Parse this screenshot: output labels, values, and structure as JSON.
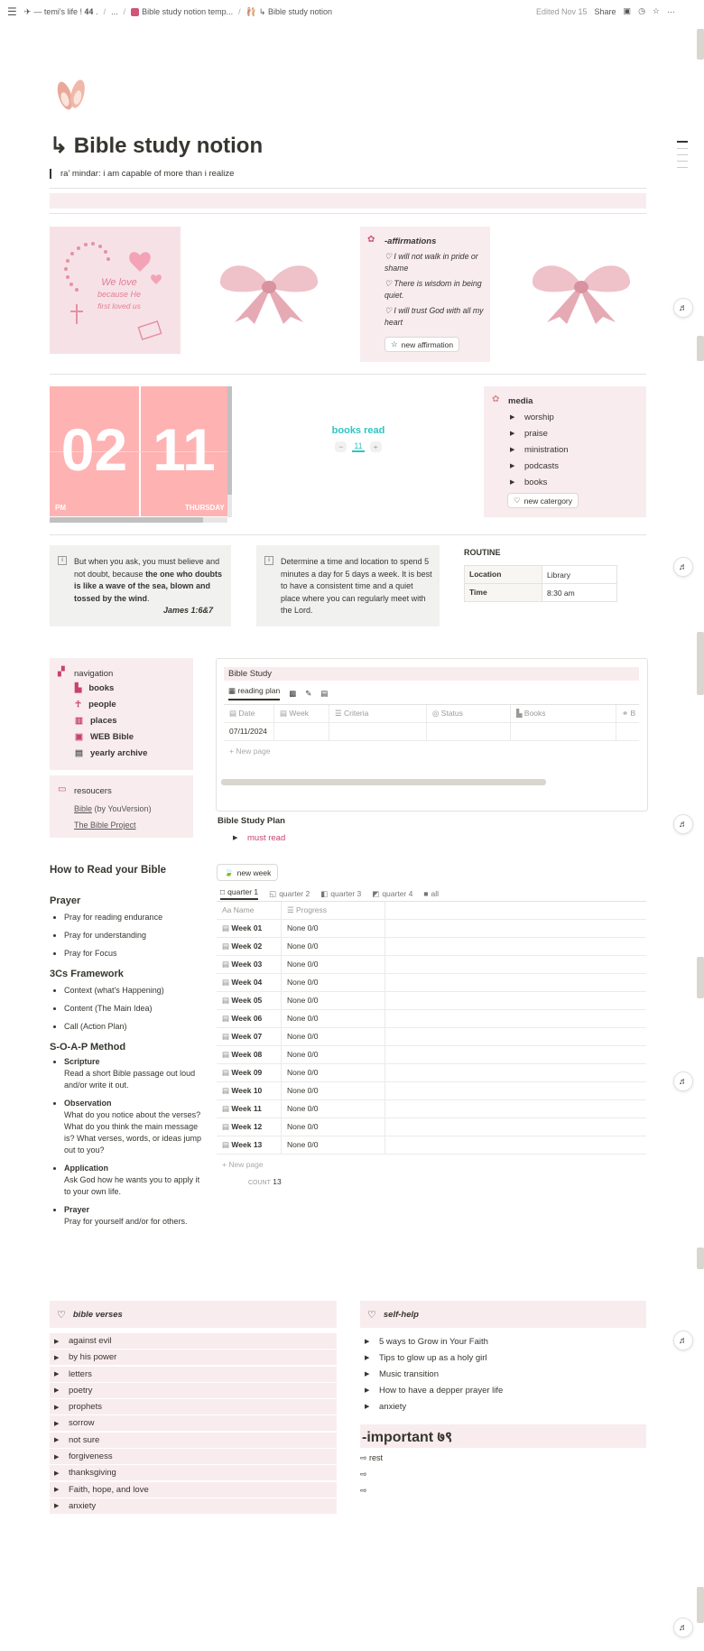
{
  "topbar": {
    "crumbs": [
      "— temi's life ! 𝟒𝟒 .",
      "...",
      "Bible study notion temp...",
      "↳ Bible study notion"
    ],
    "edited": "Edited Nov 15",
    "share": "Share"
  },
  "header": {
    "title": "↳ Bible study notion",
    "quote": "ra' mindar: i am capable of more than i realize"
  },
  "affirmations": {
    "title": "-affirmations",
    "items": [
      "I will not walk in pride or shame",
      "There is wisdom in being quiet.",
      "I will trust God with all my heart"
    ],
    "button": "new affirmation"
  },
  "sticker_text": {
    "line1": "We love",
    "line2": "because He",
    "line3": "first loved us"
  },
  "clock": {
    "hour": "02",
    "minute": "11",
    "period": "PM",
    "day": "THURSDAY"
  },
  "books_read": {
    "label": "books read",
    "value": "11",
    "minus": "−",
    "plus": "+"
  },
  "media": {
    "title": "media",
    "items": [
      "worship",
      "praise",
      "ministration",
      "podcasts",
      "books"
    ],
    "button": "new catergory"
  },
  "callouts": [
    {
      "pre": "But when you ask, you must believe and not doubt, because ",
      "bold": "the one who doubts is like a wave of the sea, blown and tossed by the wind",
      "post": ".",
      "ref": "James 1:6&7"
    },
    {
      "text": "Determine a time and location to spend 5 minutes a day for 5 days a week. It is best to have a consistent time and a quiet place where you can regularly meet with the Lord."
    }
  ],
  "routine": {
    "title": "ROUTINE",
    "rows": [
      {
        "k": "Location",
        "v": "Library"
      },
      {
        "k": "Time",
        "v": "8:30 am"
      }
    ]
  },
  "navigation": {
    "title": "navigation",
    "items": [
      "books",
      "people",
      "places",
      "WEB Bible",
      "yearly archive"
    ]
  },
  "resources": {
    "title": "resoucers",
    "bible_link": "Bible",
    "bible_suffix": " (by YouVersion)",
    "project": "The Bible Project"
  },
  "bible_study_db": {
    "title": "Bible Study",
    "view": "reading plan",
    "columns": [
      "Date",
      "Week",
      "Criteria",
      "Status",
      "Books",
      "B"
    ],
    "rows": [
      {
        "date": "07/11/2024"
      }
    ],
    "new_page": "+ New page"
  },
  "study_plan": {
    "title": "Bible Study Plan",
    "toggle": "must read"
  },
  "how_to_read": {
    "title": "How to Read your Bible",
    "prayer_heading": "Prayer",
    "prayer": [
      "Pray for reading endurance",
      "Pray for understanding",
      "Pray for Focus"
    ],
    "framework_heading": "3Cs Framework",
    "framework": [
      "Context (what's Happening)",
      "Content (The Main Idea)",
      "Call (Action Plan)"
    ],
    "soap_heading": "S-O-A-P Method",
    "soap": [
      {
        "h": "Scripture",
        "t": "Read a short Bible passage out loud and/or write it out."
      },
      {
        "h": "Observation",
        "t": "What do you notice about the verses? What do you think the main message is? What verses, words, or ideas jump out to you?"
      },
      {
        "h": "Application",
        "t": "Ask God how he wants you to apply it to your own life."
      },
      {
        "h": "Prayer",
        "t": "Pray for yourself and/or for others."
      }
    ]
  },
  "weeks": {
    "new_week": "new week",
    "tabs": [
      "quarter 1",
      "quarter 2",
      "quarter 3",
      "quarter 4",
      "all"
    ],
    "col_name": "Name",
    "col_progress": "Progress",
    "rows": [
      {
        "name": "Week 01",
        "progress": "None 0/0"
      },
      {
        "name": "Week 02",
        "progress": "None 0/0"
      },
      {
        "name": "Week 03",
        "progress": "None 0/0"
      },
      {
        "name": "Week 04",
        "progress": "None 0/0"
      },
      {
        "name": "Week 05",
        "progress": "None 0/0"
      },
      {
        "name": "Week 06",
        "progress": "None 0/0"
      },
      {
        "name": "Week 07",
        "progress": "None 0/0"
      },
      {
        "name": "Week 08",
        "progress": "None 0/0"
      },
      {
        "name": "Week 09",
        "progress": "None 0/0"
      },
      {
        "name": "Week 10",
        "progress": "None 0/0"
      },
      {
        "name": "Week 11",
        "progress": "None 0/0"
      },
      {
        "name": "Week 12",
        "progress": "None 0/0"
      },
      {
        "name": "Week 13",
        "progress": "None 0/0"
      }
    ],
    "new_page": "+ New page",
    "count_label": "COUNT",
    "count": "13"
  },
  "bible_verses": {
    "title": "bible verses",
    "items": [
      "against evil",
      "by his power",
      "letters",
      "poetry",
      "prophets",
      "sorrow",
      "not sure",
      "forgiveness",
      "thanksgiving",
      "Faith, hope, and love",
      "anxiety"
    ]
  },
  "self_help": {
    "title": "self-help",
    "items": [
      "5 ways to Grow in Your Faith",
      "Tips to glow up as a holy girl",
      "Music transition",
      "How to have a depper prayer life",
      "anxiety"
    ]
  },
  "important": {
    "title": "-important ७९",
    "items": [
      "rest",
      "",
      ""
    ]
  },
  "colors": {
    "accent_pink": "#c8426a",
    "soft_pink": "#f8ecef",
    "clock_pink": "#ffb2b2",
    "teal": "#2fc4c4"
  }
}
